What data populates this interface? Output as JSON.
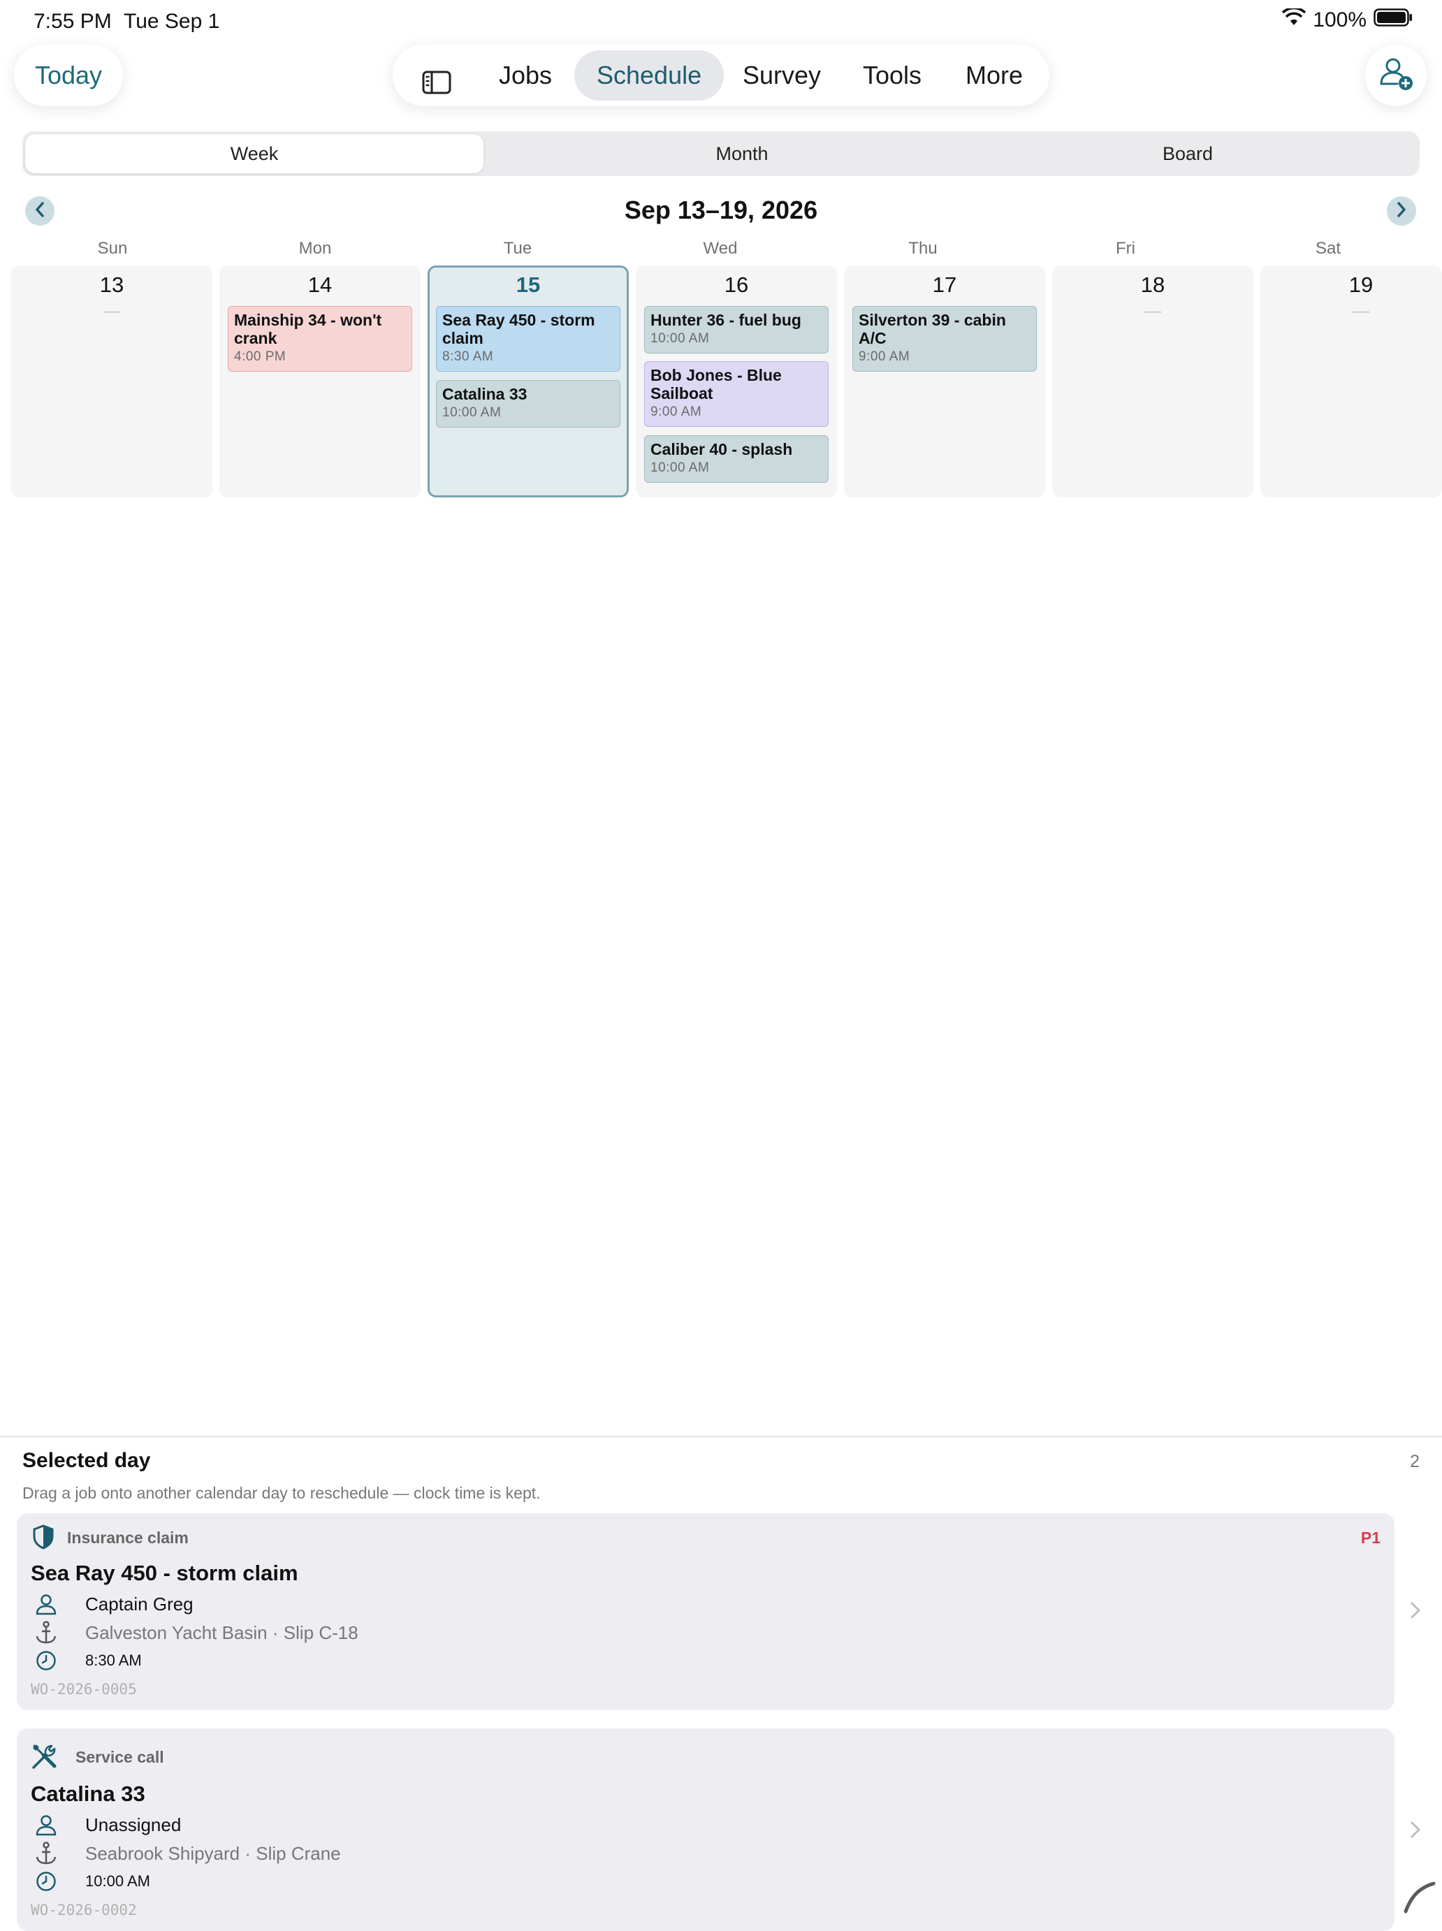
{
  "status_bar": {
    "time": "7:55 PM",
    "date": "Tue Sep 1",
    "battery": "100%"
  },
  "nav": {
    "today_label": "Today",
    "tabs": [
      "Jobs",
      "Schedule",
      "Survey",
      "Tools",
      "More"
    ],
    "active_tab": "Schedule"
  },
  "segments": {
    "items": [
      "Week",
      "Month",
      "Board"
    ],
    "selected": "Week"
  },
  "week": {
    "title": "Sep 13–19, 2026",
    "days": [
      {
        "dow": "Sun",
        "num": "13",
        "empty": "—",
        "events": []
      },
      {
        "dow": "Mon",
        "num": "14",
        "events": [
          {
            "title": "Mainship 34 - won't crank",
            "time": "4:00 PM",
            "color": "#f8d5d5"
          }
        ]
      },
      {
        "dow": "Tue",
        "num": "15",
        "today": true,
        "events": [
          {
            "title": "Sea Ray 450 - storm claim",
            "time": "8:30 AM",
            "color": "#bcdaf0"
          },
          {
            "title": "Catalina 33",
            "time": "10:00 AM",
            "color": "#c9d9dc"
          }
        ]
      },
      {
        "dow": "Wed",
        "num": "16",
        "events": [
          {
            "title": "Hunter 36 - fuel bug",
            "time": "10:00 AM",
            "color": "#c9d9dc"
          },
          {
            "title": "Bob Jones - Blue Sailboat",
            "time": "9:00 AM",
            "color": "#ddd8f4"
          },
          {
            "title": "Caliber 40 - splash",
            "time": "10:00 AM",
            "color": "#c9d9dc"
          }
        ]
      },
      {
        "dow": "Thu",
        "num": "17",
        "events": [
          {
            "title": "Silverton 39 - cabin A/C",
            "time": "9:00 AM",
            "color": "#c9d9dc"
          }
        ]
      },
      {
        "dow": "Fri",
        "num": "18",
        "empty": "—",
        "events": []
      },
      {
        "dow": "Sat",
        "num": "19",
        "empty": "—",
        "events": []
      }
    ]
  },
  "selected_day": {
    "title": "Selected day",
    "count": "2",
    "hint": "Drag a job onto another calendar day to reschedule — clock time is kept.",
    "jobs": [
      {
        "type": "Insurance claim",
        "type_icon": "shield-icon",
        "priority": "P1",
        "title": "Sea Ray 450 - storm claim",
        "assignee": "Captain Greg",
        "location": "Galveston Yacht Basin · Slip C-18",
        "time": "8:30 AM",
        "wo": "WO-2026-0005"
      },
      {
        "type": "Service call",
        "type_icon": "tools-icon",
        "title": "Catalina 33",
        "assignee": "Unassigned",
        "location": "Seabrook Shipyard · Slip Crane",
        "time": "10:00 AM",
        "wo": "WO-2026-0002"
      }
    ]
  },
  "colors": {
    "accent": "#1d6a7a",
    "priority": "#e0384f",
    "today_border": "#7aa3b0"
  }
}
